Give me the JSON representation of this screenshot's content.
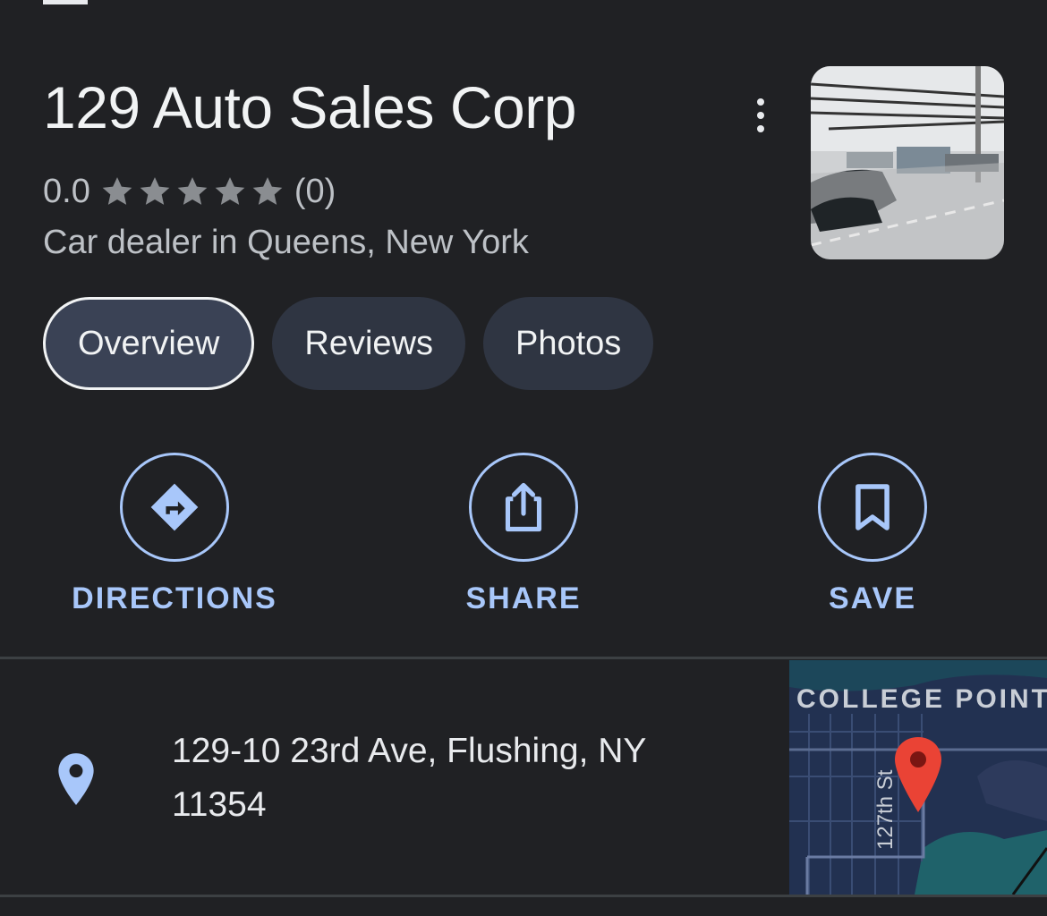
{
  "place": {
    "name": "129 Auto Sales Corp",
    "rating": "0.0",
    "rating_stars": 0,
    "review_count": "(0)",
    "category": "Car dealer in Queens, New York"
  },
  "tabs": [
    {
      "label": "Overview",
      "active": true
    },
    {
      "label": "Reviews",
      "active": false
    },
    {
      "label": "Photos",
      "active": false
    }
  ],
  "actions": {
    "directions": "DIRECTIONS",
    "share": "SHARE",
    "save": "SAVE"
  },
  "address": {
    "line1": "129-10 23rd Ave, Flushing, NY",
    "line2": "11354"
  },
  "map": {
    "area_label": "COLLEGE POINT",
    "street_label": "127th St"
  },
  "colors": {
    "background": "#202124",
    "accent": "#a8c7fa",
    "pin_red": "#ea4335",
    "map_bg": "#223151"
  }
}
